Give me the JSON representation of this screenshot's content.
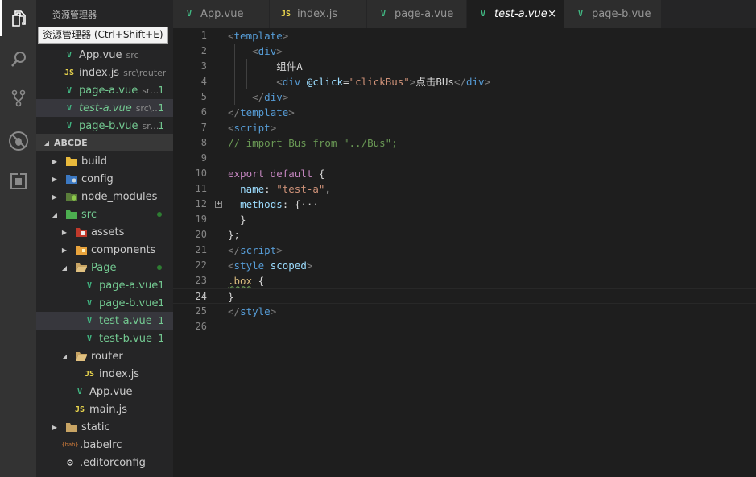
{
  "activity_bar": {
    "items": [
      {
        "name": "explorer-icon",
        "active": true
      },
      {
        "name": "search-icon",
        "active": false
      },
      {
        "name": "source-control-icon",
        "active": false
      },
      {
        "name": "debug-icon",
        "active": false
      },
      {
        "name": "extensions-icon",
        "active": false
      }
    ]
  },
  "sidebar": {
    "title": "资源管理器",
    "tooltip": "资源管理器 (Ctrl+Shift+E)",
    "open_editors": [
      {
        "name": "App.vue",
        "desc": "src",
        "icon": "vue",
        "badge": ""
      },
      {
        "name": "index.js",
        "desc": "src\\router",
        "icon": "js",
        "badge": ""
      },
      {
        "name": "page-a.vue",
        "desc": "src...",
        "icon": "vue",
        "badge": "1"
      },
      {
        "name": "test-a.vue",
        "desc": "src\\P...",
        "icon": "vue",
        "badge": "1"
      },
      {
        "name": "page-b.vue",
        "desc": "src...",
        "icon": "vue",
        "badge": "1"
      }
    ],
    "project_title": "ABCDE",
    "tree": [
      {
        "name": "build",
        "icon": "folder-build"
      },
      {
        "name": "config",
        "icon": "folder-config"
      },
      {
        "name": "node_modules",
        "icon": "folder-node"
      },
      {
        "name": "src",
        "icon": "folder-src"
      },
      {
        "name": "assets",
        "icon": "folder-assets"
      },
      {
        "name": "components",
        "icon": "folder-components"
      },
      {
        "name": "Page",
        "icon": "folder-open"
      },
      {
        "name": "page-a.vue",
        "icon": "vue",
        "badge": "1"
      },
      {
        "name": "page-b.vue",
        "icon": "vue",
        "badge": "1"
      },
      {
        "name": "test-a.vue",
        "icon": "vue",
        "badge": "1"
      },
      {
        "name": "test-b.vue",
        "icon": "vue",
        "badge": "1"
      },
      {
        "name": "router",
        "icon": "folder-open"
      },
      {
        "name": "index.js",
        "icon": "js"
      },
      {
        "name": "App.vue",
        "icon": "vue"
      },
      {
        "name": "main.js",
        "icon": "js"
      },
      {
        "name": "static",
        "icon": "folder"
      },
      {
        "name": ".babelrc",
        "icon": "babelrc"
      },
      {
        "name": ".editorconfig",
        "icon": "editorconfig"
      }
    ]
  },
  "icons": {
    "js": "JS",
    "vue": "V",
    "babelrc": "{bab}",
    "gear": "⚙"
  },
  "tabs": [
    {
      "label": "App.vue",
      "icon": "vue"
    },
    {
      "label": "index.js",
      "icon": "js"
    },
    {
      "label": "page-a.vue",
      "icon": "vue"
    },
    {
      "label": "test-a.vue",
      "icon": "vue",
      "active": true,
      "close": "×"
    },
    {
      "label": "page-b.vue",
      "icon": "vue"
    }
  ],
  "editor": {
    "current_line": "24",
    "lines": [
      {
        "n": "1",
        "tokens": [
          [
            "t-tag",
            "<"
          ],
          [
            "t-name",
            "template"
          ],
          [
            "t-tag",
            ">"
          ]
        ]
      },
      {
        "n": "2",
        "tokens": [
          [
            "t-text",
            "    "
          ],
          [
            "t-tag",
            "<"
          ],
          [
            "t-name",
            "div"
          ],
          [
            "t-tag",
            ">"
          ]
        ]
      },
      {
        "n": "3",
        "tokens": [
          [
            "t-text",
            "        组件A"
          ]
        ]
      },
      {
        "n": "4",
        "tokens": [
          [
            "t-text",
            "        "
          ],
          [
            "t-tag",
            "<"
          ],
          [
            "t-name",
            "div "
          ],
          [
            "t-attr",
            "@click"
          ],
          [
            "t-text",
            "="
          ],
          [
            "t-str",
            "\"clickBus\""
          ],
          [
            "t-tag",
            ">"
          ],
          [
            "t-text",
            "点击BUs"
          ],
          [
            "t-tag",
            "</"
          ],
          [
            "t-name",
            "div"
          ],
          [
            "t-tag",
            ">"
          ]
        ]
      },
      {
        "n": "5",
        "tokens": [
          [
            "t-text",
            "    "
          ],
          [
            "t-tag",
            "</"
          ],
          [
            "t-name",
            "div"
          ],
          [
            "t-tag",
            ">"
          ]
        ]
      },
      {
        "n": "6",
        "tokens": [
          [
            "t-tag",
            "</"
          ],
          [
            "t-name",
            "template"
          ],
          [
            "t-tag",
            ">"
          ]
        ]
      },
      {
        "n": "7",
        "tokens": [
          [
            "t-tag",
            "<"
          ],
          [
            "t-name",
            "script"
          ],
          [
            "t-tag",
            ">"
          ]
        ]
      },
      {
        "n": "8",
        "tokens": [
          [
            "t-cmt",
            "// import Bus from \"../Bus\";"
          ]
        ]
      },
      {
        "n": "9",
        "tokens": []
      },
      {
        "n": "10",
        "tokens": [
          [
            "t-kw",
            "export default "
          ],
          [
            "t-text",
            "{"
          ]
        ]
      },
      {
        "n": "11",
        "tokens": [
          [
            "t-text",
            "  "
          ],
          [
            "t-prop",
            "name"
          ],
          [
            "t-text",
            ": "
          ],
          [
            "t-str",
            "\"test-a\""
          ],
          [
            "t-text",
            ","
          ]
        ]
      },
      {
        "n": "12",
        "tokens": [
          [
            "t-text",
            "  "
          ],
          [
            "t-prop",
            "methods"
          ],
          [
            "t-text",
            ": {"
          ],
          [
            "t-text",
            "···"
          ]
        ],
        "fold": "+"
      },
      {
        "n": "19",
        "tokens": [
          [
            "t-text",
            "  }"
          ]
        ]
      },
      {
        "n": "20",
        "tokens": [
          [
            "t-text",
            "};"
          ]
        ]
      },
      {
        "n": "21",
        "tokens": [
          [
            "t-tag",
            "</"
          ],
          [
            "t-name",
            "script"
          ],
          [
            "t-tag",
            ">"
          ]
        ]
      },
      {
        "n": "22",
        "tokens": [
          [
            "t-tag",
            "<"
          ],
          [
            "t-name",
            "style "
          ],
          [
            "t-attr",
            "scoped"
          ],
          [
            "t-tag",
            ">"
          ]
        ]
      },
      {
        "n": "23",
        "tokens": [
          [
            "t-sel",
            ".box"
          ],
          [
            "t-text",
            " {"
          ]
        ]
      },
      {
        "n": "24",
        "tokens": [
          [
            "t-text",
            "}"
          ]
        ]
      },
      {
        "n": "25",
        "tokens": [
          [
            "t-tag",
            "</"
          ],
          [
            "t-name",
            "style"
          ],
          [
            "t-tag",
            ">"
          ]
        ]
      },
      {
        "n": "26",
        "tokens": []
      }
    ]
  }
}
